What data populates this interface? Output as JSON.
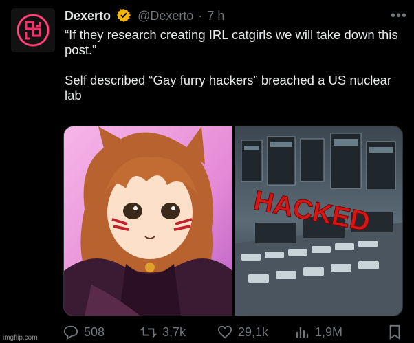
{
  "author": {
    "name": "Dexerto",
    "handle": "@Dexerto",
    "time": "7 h",
    "separator": "·"
  },
  "tweet": {
    "line1": "“If they research creating IRL catgirls we will take down this post.”",
    "line2": "Self described “Gay furry hackers” breached a US nuclear lab"
  },
  "media": {
    "right_overlay": "HACKED"
  },
  "actions": {
    "replies": "508",
    "retweets": "3,7k",
    "likes": "29,1k",
    "views": "1,9M"
  },
  "watermark": "imgflip.com",
  "colors": {
    "accent_verified": "#f4b400",
    "text_primary": "#e7e9ea",
    "text_secondary": "#71767b",
    "hacked_red": "#d31717"
  }
}
